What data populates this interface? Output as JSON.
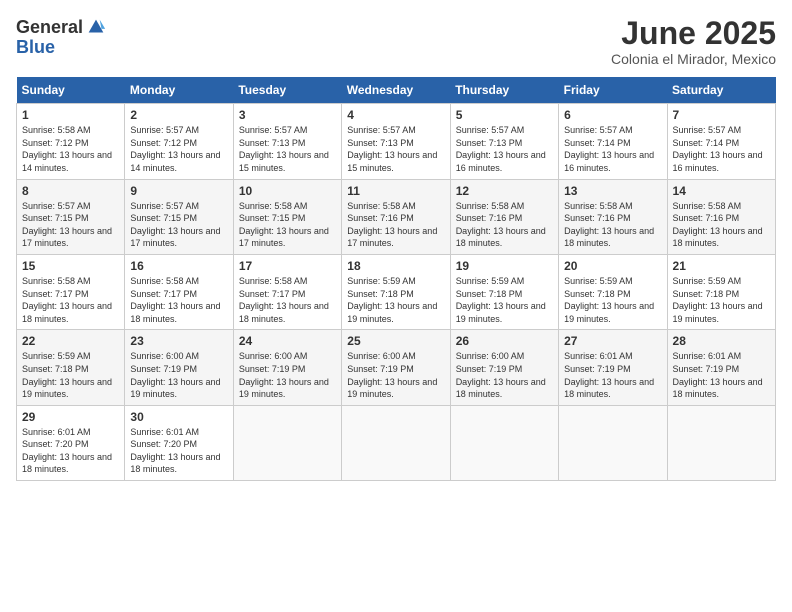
{
  "logo": {
    "general": "General",
    "blue": "Blue"
  },
  "header": {
    "month": "June 2025",
    "location": "Colonia el Mirador, Mexico"
  },
  "weekdays": [
    "Sunday",
    "Monday",
    "Tuesday",
    "Wednesday",
    "Thursday",
    "Friday",
    "Saturday"
  ],
  "weeks": [
    [
      {
        "day": 1,
        "sunrise": "5:58 AM",
        "sunset": "7:12 PM",
        "daylight": "13 hours and 14 minutes."
      },
      {
        "day": 2,
        "sunrise": "5:57 AM",
        "sunset": "7:12 PM",
        "daylight": "13 hours and 14 minutes."
      },
      {
        "day": 3,
        "sunrise": "5:57 AM",
        "sunset": "7:13 PM",
        "daylight": "13 hours and 15 minutes."
      },
      {
        "day": 4,
        "sunrise": "5:57 AM",
        "sunset": "7:13 PM",
        "daylight": "13 hours and 15 minutes."
      },
      {
        "day": 5,
        "sunrise": "5:57 AM",
        "sunset": "7:13 PM",
        "daylight": "13 hours and 16 minutes."
      },
      {
        "day": 6,
        "sunrise": "5:57 AM",
        "sunset": "7:14 PM",
        "daylight": "13 hours and 16 minutes."
      },
      {
        "day": 7,
        "sunrise": "5:57 AM",
        "sunset": "7:14 PM",
        "daylight": "13 hours and 16 minutes."
      }
    ],
    [
      {
        "day": 8,
        "sunrise": "5:57 AM",
        "sunset": "7:15 PM",
        "daylight": "13 hours and 17 minutes."
      },
      {
        "day": 9,
        "sunrise": "5:57 AM",
        "sunset": "7:15 PM",
        "daylight": "13 hours and 17 minutes."
      },
      {
        "day": 10,
        "sunrise": "5:58 AM",
        "sunset": "7:15 PM",
        "daylight": "13 hours and 17 minutes."
      },
      {
        "day": 11,
        "sunrise": "5:58 AM",
        "sunset": "7:16 PM",
        "daylight": "13 hours and 17 minutes."
      },
      {
        "day": 12,
        "sunrise": "5:58 AM",
        "sunset": "7:16 PM",
        "daylight": "13 hours and 18 minutes."
      },
      {
        "day": 13,
        "sunrise": "5:58 AM",
        "sunset": "7:16 PM",
        "daylight": "13 hours and 18 minutes."
      },
      {
        "day": 14,
        "sunrise": "5:58 AM",
        "sunset": "7:16 PM",
        "daylight": "13 hours and 18 minutes."
      }
    ],
    [
      {
        "day": 15,
        "sunrise": "5:58 AM",
        "sunset": "7:17 PM",
        "daylight": "13 hours and 18 minutes."
      },
      {
        "day": 16,
        "sunrise": "5:58 AM",
        "sunset": "7:17 PM",
        "daylight": "13 hours and 18 minutes."
      },
      {
        "day": 17,
        "sunrise": "5:58 AM",
        "sunset": "7:17 PM",
        "daylight": "13 hours and 18 minutes."
      },
      {
        "day": 18,
        "sunrise": "5:59 AM",
        "sunset": "7:18 PM",
        "daylight": "13 hours and 19 minutes."
      },
      {
        "day": 19,
        "sunrise": "5:59 AM",
        "sunset": "7:18 PM",
        "daylight": "13 hours and 19 minutes."
      },
      {
        "day": 20,
        "sunrise": "5:59 AM",
        "sunset": "7:18 PM",
        "daylight": "13 hours and 19 minutes."
      },
      {
        "day": 21,
        "sunrise": "5:59 AM",
        "sunset": "7:18 PM",
        "daylight": "13 hours and 19 minutes."
      }
    ],
    [
      {
        "day": 22,
        "sunrise": "5:59 AM",
        "sunset": "7:18 PM",
        "daylight": "13 hours and 19 minutes."
      },
      {
        "day": 23,
        "sunrise": "6:00 AM",
        "sunset": "7:19 PM",
        "daylight": "13 hours and 19 minutes."
      },
      {
        "day": 24,
        "sunrise": "6:00 AM",
        "sunset": "7:19 PM",
        "daylight": "13 hours and 19 minutes."
      },
      {
        "day": 25,
        "sunrise": "6:00 AM",
        "sunset": "7:19 PM",
        "daylight": "13 hours and 19 minutes."
      },
      {
        "day": 26,
        "sunrise": "6:00 AM",
        "sunset": "7:19 PM",
        "daylight": "13 hours and 18 minutes."
      },
      {
        "day": 27,
        "sunrise": "6:01 AM",
        "sunset": "7:19 PM",
        "daylight": "13 hours and 18 minutes."
      },
      {
        "day": 28,
        "sunrise": "6:01 AM",
        "sunset": "7:19 PM",
        "daylight": "13 hours and 18 minutes."
      }
    ],
    [
      {
        "day": 29,
        "sunrise": "6:01 AM",
        "sunset": "7:20 PM",
        "daylight": "13 hours and 18 minutes."
      },
      {
        "day": 30,
        "sunrise": "6:01 AM",
        "sunset": "7:20 PM",
        "daylight": "13 hours and 18 minutes."
      },
      null,
      null,
      null,
      null,
      null
    ]
  ]
}
